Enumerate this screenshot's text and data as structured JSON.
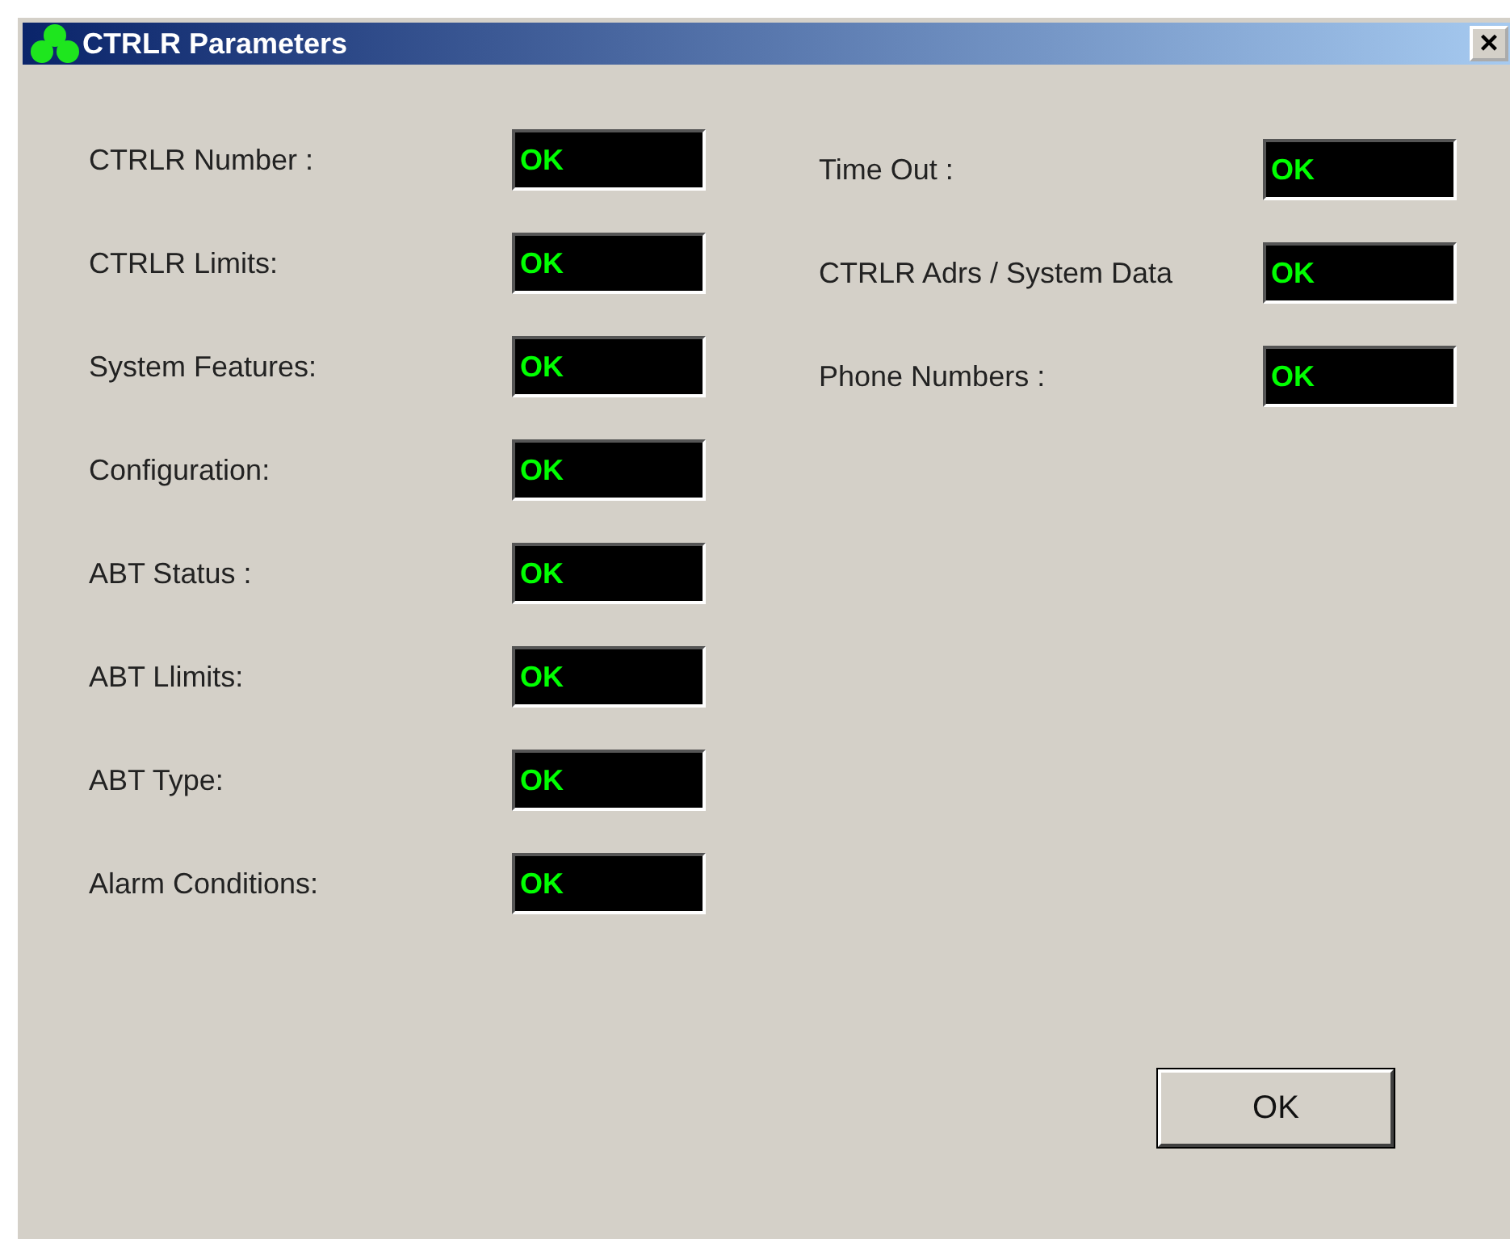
{
  "window": {
    "title": "CTRLR Parameters",
    "close": "×"
  },
  "left_fields": [
    {
      "label": "CTRLR  Number :",
      "value": "OK"
    },
    {
      "label": "CTRLR Limits:",
      "value": "OK"
    },
    {
      "label": "System Features:",
      "value": "OK"
    },
    {
      "label": "Configuration:",
      "value": "OK"
    },
    {
      "label": "ABT Status :",
      "value": "OK"
    },
    {
      "label": "ABT Llimits:",
      "value": "OK"
    },
    {
      "label": "ABT Type:",
      "value": "OK"
    },
    {
      "label": "Alarm Conditions:",
      "value": "OK"
    }
  ],
  "right_fields": [
    {
      "label": "Time Out :",
      "value": "OK"
    },
    {
      "label": "CTRLR Adrs / System Data",
      "value": "OK"
    },
    {
      "label": "Phone Numbers :",
      "value": "OK"
    }
  ],
  "buttons": [
    "OK"
  ]
}
